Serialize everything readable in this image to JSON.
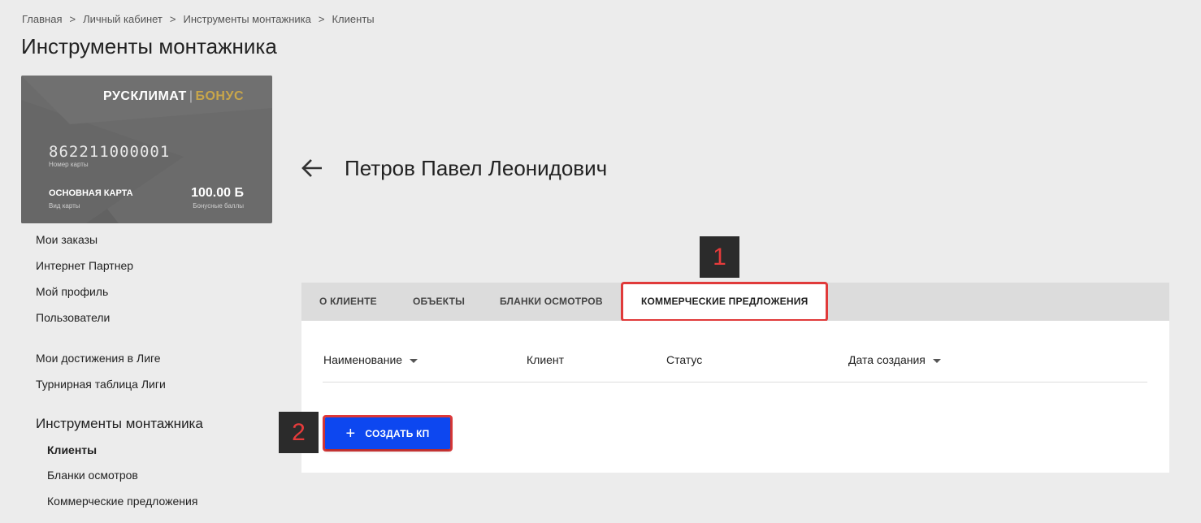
{
  "breadcrumb": {
    "items": [
      "Главная",
      "Личный кабинет",
      "Инструменты монтажника",
      "Клиенты"
    ],
    "separator": ">"
  },
  "page_title": "Инструменты монтажника",
  "card": {
    "brand": "РУСКЛИМАТ",
    "brand_divider": "|",
    "brand_suffix": "БОНУС",
    "number": "862211000001",
    "number_label": "Номер карты",
    "type": "ОСНОВНАЯ КАРТА",
    "type_label": "Вид карты",
    "points": "100.00 Б",
    "points_label": "Бонусные баллы",
    "accent_color": "#c9a64a"
  },
  "sidebar": {
    "items": [
      "Мои заказы",
      "Интернет Партнер",
      "Мой профиль",
      "Пользователи"
    ],
    "league_items": [
      "Мои достижения в Лиге",
      "Турнирная таблица Лиги"
    ],
    "section_title": "Инструменты монтажника",
    "sub_items": [
      "Клиенты",
      "Бланки осмотров",
      "Коммерческие предложения"
    ],
    "active_sub_item": "Клиенты"
  },
  "client": {
    "name": "Петров Павел Леонидович",
    "back_icon": "arrow-left-icon"
  },
  "tabs": [
    "О КЛИЕНТЕ",
    "ОБЪЕКТЫ",
    "БЛАНКИ ОСМОТРОВ",
    "КОММЕРЧЕСКИЕ ПРЕДЛОЖЕНИЯ"
  ],
  "active_tab": "КОММЕРЧЕСКИЕ ПРЕДЛОЖЕНИЯ",
  "table": {
    "columns": [
      "Наименование",
      "Клиент",
      "Статус",
      "Дата создания"
    ]
  },
  "create_button": {
    "icon": "+",
    "label": "СОЗДАТЬ КП",
    "color": "#0d47f0"
  },
  "annotations": {
    "marker_1": "1",
    "marker_2": "2",
    "highlight_color": "#e03a3a"
  }
}
